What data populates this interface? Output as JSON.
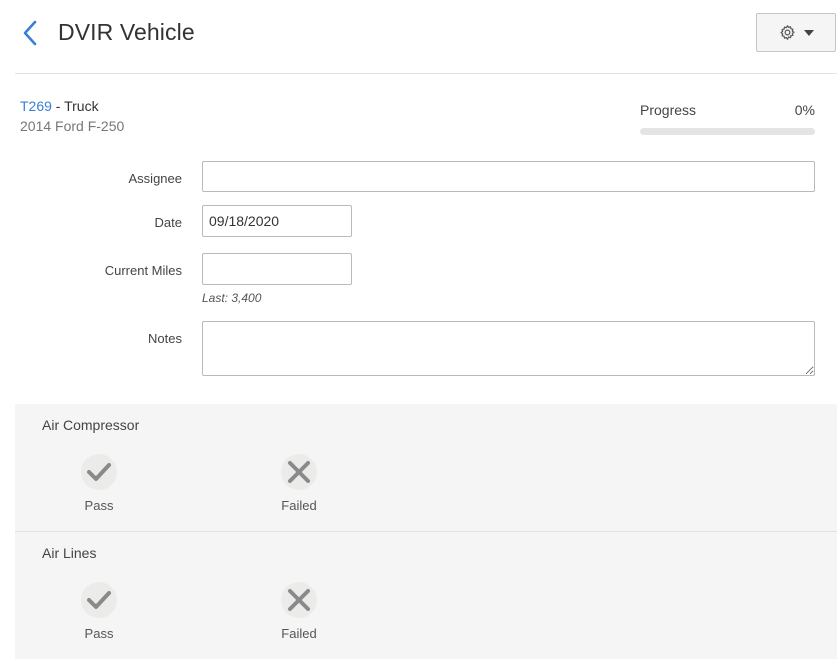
{
  "header": {
    "title": "DVIR Vehicle",
    "back_icon": "chevron-left-icon",
    "settings_icon": "gear-icon",
    "dropdown_icon": "caret-down-icon"
  },
  "vehicle": {
    "id": "T269",
    "type": " - Truck",
    "description": "2014 Ford F-250"
  },
  "progress": {
    "label": "Progress",
    "value_text": "0%",
    "value": 0
  },
  "form": {
    "assignee": {
      "label": "Assignee",
      "value": ""
    },
    "date": {
      "label": "Date",
      "value": "09/18/2020"
    },
    "current_miles": {
      "label": "Current Miles",
      "value": "",
      "hint": "Last: 3,400"
    },
    "notes": {
      "label": "Notes",
      "value": ""
    }
  },
  "inspections": [
    {
      "title": "Air Compressor",
      "pass_label": "Pass",
      "fail_label": "Failed"
    },
    {
      "title": "Air Lines",
      "pass_label": "Pass",
      "fail_label": "Failed"
    }
  ],
  "colors": {
    "accent": "#3a7fd5",
    "icon_gray": "#8a8a8a",
    "section_bg": "#f4f5f4"
  }
}
